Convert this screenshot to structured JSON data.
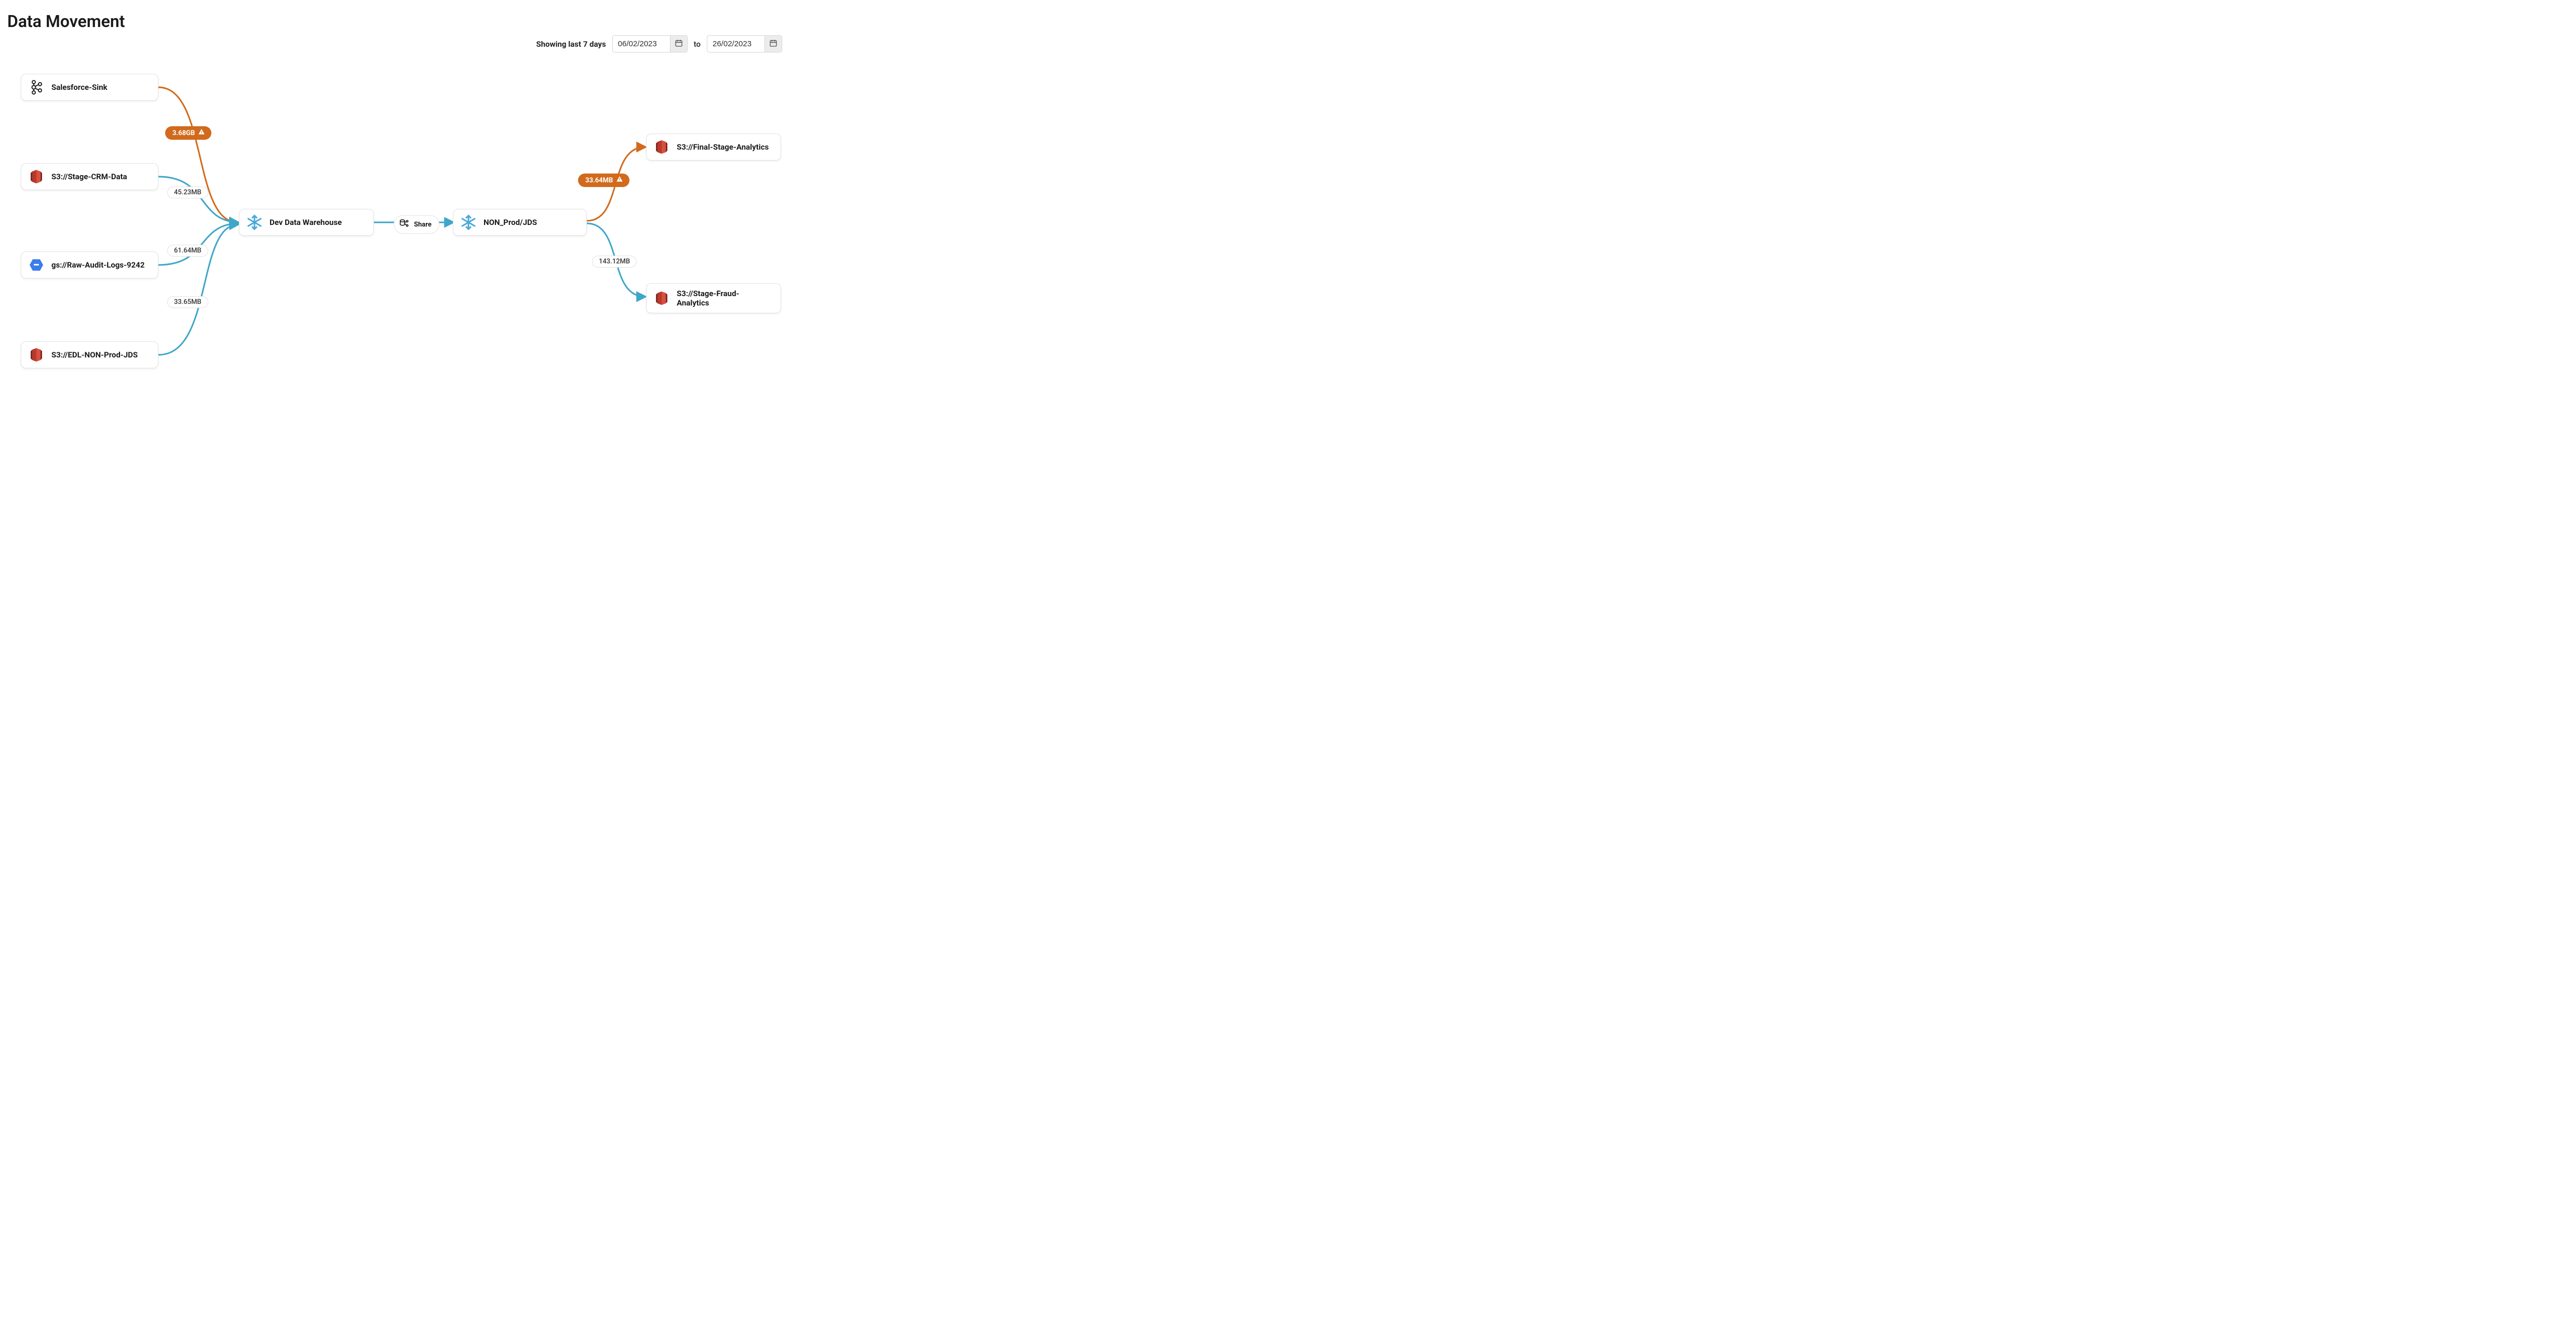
{
  "page": {
    "title": "Data Movement"
  },
  "dateRange": {
    "showing_label": "Showing last 7 days",
    "from": "06/02/2023",
    "to_label": "to",
    "to": "26/02/2023"
  },
  "colors": {
    "edge_blue": "#3da7c9",
    "edge_orange": "#d16a1c",
    "snowflake": "#4aa8d8",
    "aws": "#b63a2d",
    "gcp": "#3b7ded"
  },
  "nodes": {
    "salesforce_sink": {
      "label": "Salesforce-Sink",
      "icon": "kafka"
    },
    "stage_crm": {
      "label": "S3://Stage-CRM-Data",
      "icon": "aws"
    },
    "raw_audit": {
      "label": "gs://Raw-Audit-Logs-9242",
      "icon": "gcp"
    },
    "edl_non_prod": {
      "label": "S3://EDL-NON-Prod-JDS",
      "icon": "aws"
    },
    "dev_dw": {
      "label": "Dev Data Warehouse",
      "icon": "snowflake"
    },
    "non_prod_jds": {
      "label": "NON_Prod/JDS",
      "icon": "snowflake"
    },
    "final_stage": {
      "label": "S3://Final-Stage-Analytics",
      "icon": "aws"
    },
    "stage_fraud": {
      "label": "S3://Stage-Fraud-Analytics",
      "icon": "aws"
    }
  },
  "edges": {
    "salesforce_to_dw": {
      "label": "3.68GB",
      "warn": true
    },
    "crm_to_dw": {
      "label": "45.23MB"
    },
    "audit_to_dw": {
      "label": "61.64MB"
    },
    "edl_to_dw": {
      "label": "33.65MB"
    },
    "dw_to_jds": {
      "label": "Share"
    },
    "jds_to_final": {
      "label": "33.64MB",
      "warn": true
    },
    "jds_to_fraud": {
      "label": "143.12MB"
    }
  }
}
